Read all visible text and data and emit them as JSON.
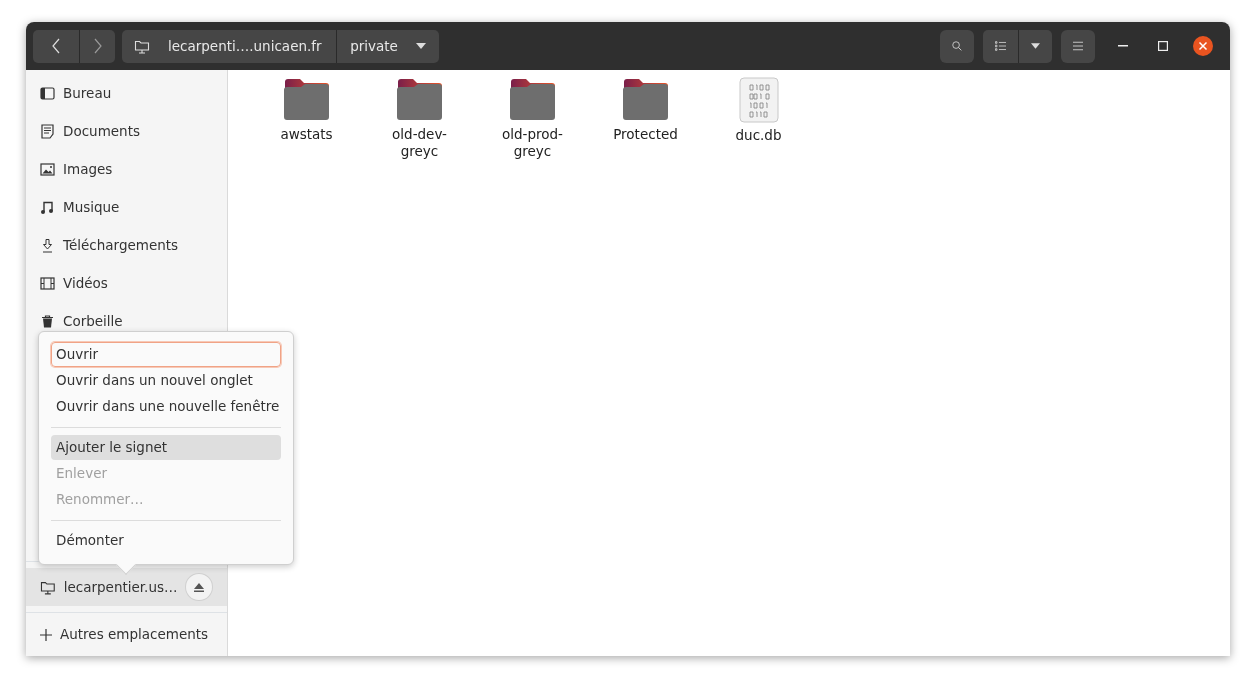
{
  "header": {
    "location": "lecarpenti….unicaen.fr",
    "folder": "private"
  },
  "sidebar": {
    "places": [
      {
        "label": "Bureau",
        "selected": false
      },
      {
        "label": "Documents",
        "selected": false
      },
      {
        "label": "Images",
        "selected": false
      },
      {
        "label": "Musique",
        "selected": false
      },
      {
        "label": "Téléchargements",
        "selected": false
      },
      {
        "label": "Vidéos",
        "selected": false
      },
      {
        "label": "Corbeille",
        "selected": false
      }
    ],
    "mounts": [
      {
        "label": "lecarpentier.us…",
        "selected": true
      }
    ],
    "other": {
      "label": "Autres emplacements"
    }
  },
  "files": [
    {
      "name": "awstats",
      "kind": "folder"
    },
    {
      "name": "old-dev-greyc",
      "kind": "folder"
    },
    {
      "name": "old-prod-greyc",
      "kind": "folder"
    },
    {
      "name": "Protected",
      "kind": "folder"
    },
    {
      "name": "duc.db",
      "kind": "binary"
    }
  ],
  "context_menu": {
    "sections": [
      [
        {
          "label": "Ouvrir",
          "focused": true,
          "hovered": false,
          "disabled": false
        },
        {
          "label": "Ouvrir dans un nouvel onglet",
          "focused": false,
          "hovered": false,
          "disabled": false
        },
        {
          "label": "Ouvrir dans une nouvelle fenêtre",
          "focused": false,
          "hovered": false,
          "disabled": false
        }
      ],
      [
        {
          "label": "Ajouter le signet",
          "focused": false,
          "hovered": true,
          "disabled": false
        },
        {
          "label": "Enlever",
          "focused": false,
          "hovered": false,
          "disabled": true
        },
        {
          "label": "Renommer…",
          "focused": false,
          "hovered": false,
          "disabled": true
        }
      ],
      [
        {
          "label": "Démonter",
          "focused": false,
          "hovered": false,
          "disabled": false
        }
      ]
    ]
  }
}
